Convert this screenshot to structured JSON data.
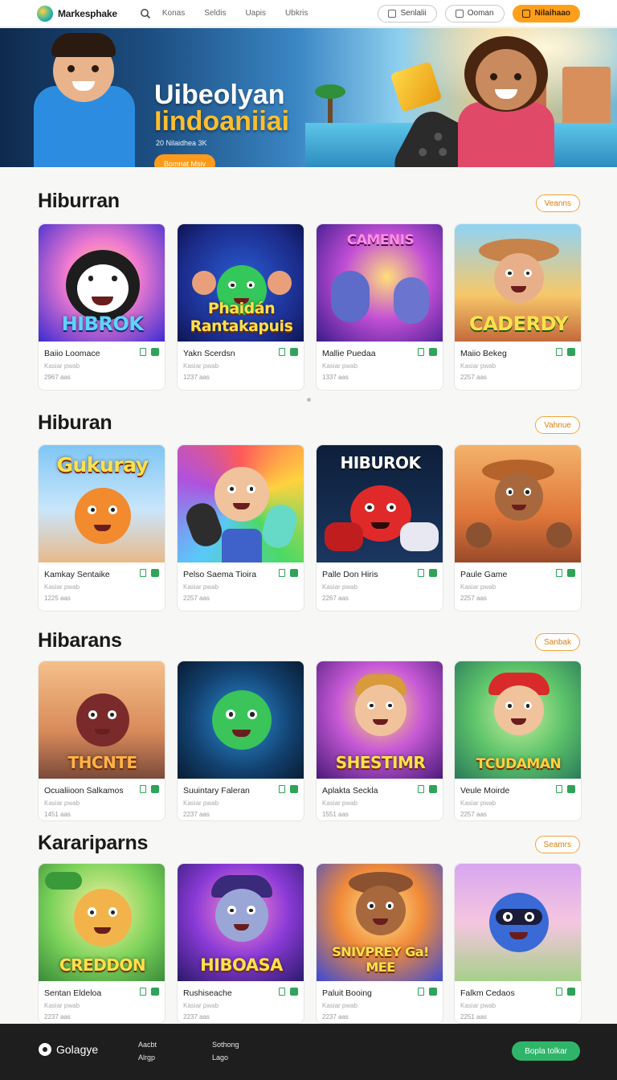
{
  "header": {
    "brand": "Markesphake",
    "nav": [
      "Konas",
      "Seldis",
      "Uapis",
      "Ubkris"
    ],
    "btn_outline_1": "Senlalii",
    "btn_outline_2": "Ooman",
    "btn_primary": "Nilaihaao"
  },
  "hero": {
    "title_line1": "Uibeolyan",
    "title_line2": "Iindoaniiai",
    "subtitle": "20 Nilaidhea 3K",
    "cta": "Bomnat Msiv"
  },
  "sections": [
    {
      "title": "Hiburran",
      "pill": "Veanns",
      "cards": [
        {
          "art": "HIBROK",
          "title": "Baiio Loomace",
          "sub": "Kasiar pwab",
          "count": "2967 aas"
        },
        {
          "art": "Phaidán Rantakapuis",
          "title": "Yakn Scerdsn",
          "sub": "Kasiar pwab",
          "count": "1237 aas"
        },
        {
          "art": "CAMENIS",
          "title": "Mallie Puedaa",
          "sub": "Kasiar pwab",
          "count": "1337 aas"
        },
        {
          "art": "CADERDY",
          "title": "Maiio Bekeg",
          "sub": "Kasiar pwab",
          "count": "2257 aas"
        }
      ]
    },
    {
      "title": "Hiburan",
      "pill": "Vahnue",
      "cards": [
        {
          "art": "Gukuray",
          "title": "Kamkay Sentaike",
          "sub": "Kasiar pwab",
          "count": "1225 aas"
        },
        {
          "art": "",
          "title": "Pelso Saema Tioira",
          "sub": "Kasiar pwab",
          "count": "2257 aas"
        },
        {
          "art": "HIBUROK",
          "title": "Palle Don Hiris",
          "sub": "Kasiar pwab",
          "count": "2267 aas"
        },
        {
          "art": "",
          "title": "Paule Game",
          "sub": "Kasiar pwab",
          "count": "2257 aas"
        }
      ]
    },
    {
      "title": "Hibarans",
      "pill": "Sanbak",
      "cards": [
        {
          "art": "THCNTE",
          "title": "Ocualiioon Salkamos",
          "sub": "Kasiar pwab",
          "count": "1451 aas"
        },
        {
          "art": "",
          "title": "Suuintary Faleran",
          "sub": "Kasiar pwab",
          "count": "2237 aas"
        },
        {
          "art": "SHESTIMR",
          "title": "Aplakta Seckla",
          "sub": "Kasiar pwab",
          "count": "1551 aas"
        },
        {
          "art": "TCUDAMAN",
          "title": "Veule Moirde",
          "sub": "Kasiar pwab",
          "count": "2257 aas"
        }
      ]
    },
    {
      "title": "Karariparns",
      "pill": "Seamrs",
      "cards": [
        {
          "art": "CREDDON",
          "title": "Sentan Eldeloa",
          "sub": "Kasiar pwab",
          "count": "2237 aas"
        },
        {
          "art": "HIBOASA",
          "title": "Rushiseache",
          "sub": "Kasiar pwab",
          "count": "2237 aas"
        },
        {
          "art": "SNIVPREY Ga! MEE",
          "title": "Paluit Booing",
          "sub": "Kasiar pwab",
          "count": "2237 aas"
        },
        {
          "art": "",
          "title": "Falkm Cedaos",
          "sub": "Kasiar pwab",
          "count": "2251 aas"
        }
      ]
    }
  ],
  "footer": {
    "brand": "Golagye",
    "col1": [
      "Aacbt",
      "Alrgp"
    ],
    "col2": [
      "Sothong",
      "Lago"
    ],
    "cta": "Bopla tolkar"
  },
  "colors": {
    "accent": "#ff9f1c",
    "pill_border": "#f4a338",
    "green": "#2fb56a",
    "footer_bg": "#1e1e1e"
  }
}
